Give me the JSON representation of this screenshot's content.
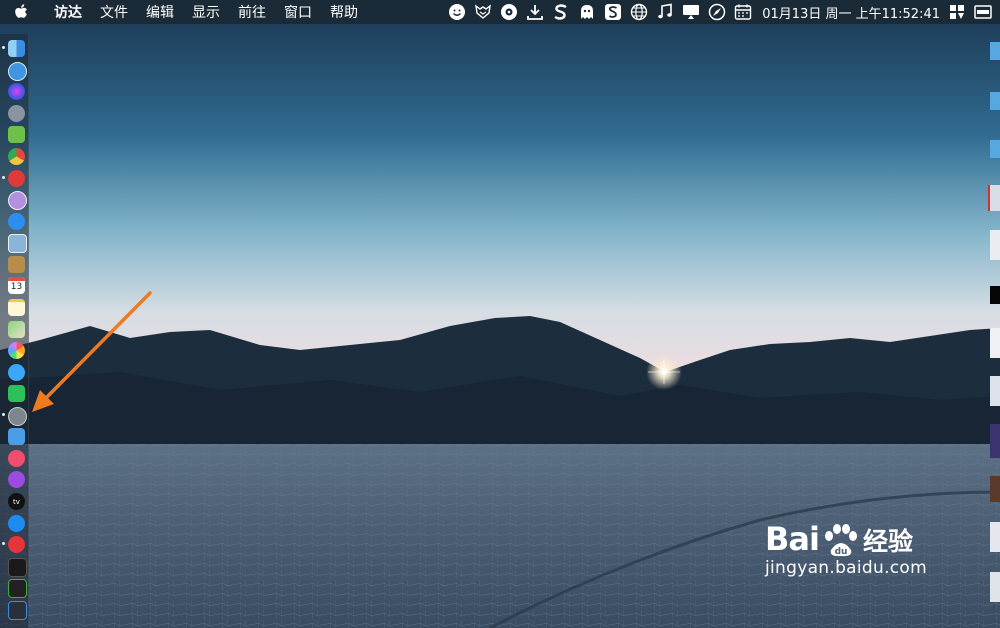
{
  "menubar": {
    "menus": [
      "访达",
      "文件",
      "编辑",
      "显示",
      "前往",
      "窗口",
      "帮助"
    ],
    "clock": "01月13日 周一 上午11:52:41",
    "status_icons": [
      "emoji-icon",
      "fox-icon",
      "eye-icon",
      "download-icon",
      "s-icon",
      "ghost-icon",
      "sogou-icon",
      "globe-icon",
      "music-note-icon",
      "display-icon",
      "safari-compass-icon",
      "calendar-icon"
    ]
  },
  "dock": {
    "apps": [
      "finder",
      "safari-compass",
      "siri",
      "launchpad-rocket",
      "android-studio",
      "chrome",
      "foxit",
      "kuaijie",
      "safari",
      "preview",
      "notes-brown",
      "calendar",
      "notes",
      "maps",
      "photos",
      "messages",
      "wechat",
      "system-preferences",
      "keynote",
      "music",
      "podcasts",
      "apple-tv",
      "app-store",
      "vivaldi",
      "terminal",
      "activity-monitor",
      "misc"
    ],
    "calendar_day": "13",
    "tv_label": "tv"
  },
  "watermark": {
    "logo_text_1": "Bai",
    "logo_text_2": "du",
    "logo_cn": "经验",
    "url": "jingyan.baidu.com"
  },
  "colors": {
    "menubar_bg": "#1b2a37",
    "arrow": "#f07a1f",
    "sky_top": "#1f3a55",
    "sky_bottom": "#e9dde3"
  }
}
